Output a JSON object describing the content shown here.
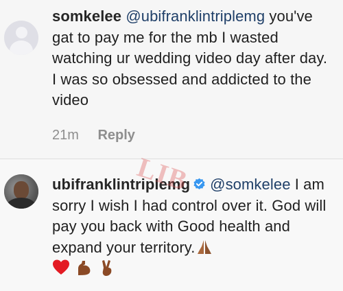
{
  "comments": [
    {
      "username": "somkelee",
      "mention": "@ubifranklintriplemg",
      "text": " you've gat to pay me for the mb I wasted watching ur wedding video day after day. I was so obsessed and addicted to the video",
      "time": "21m",
      "reply_label": "Reply",
      "avatar": "default-avatar-icon"
    },
    {
      "username": "ubifranklintriplemg",
      "verified": true,
      "mention": "@somkelee",
      "text": " I am sorry I wish I had control over it. God will pay you back with Good health and expand your territory.",
      "emojis": [
        "praying-hands-emoji",
        "red-heart-emoji",
        "flexed-biceps-emoji",
        "victory-hand-emoji"
      ],
      "avatar": "profile-photo"
    }
  ],
  "watermark": "LIB",
  "colors": {
    "mention": "#1f3f68",
    "verified": "#3897f0",
    "meta": "#8e8e8e",
    "background": "#f7f7f7"
  }
}
